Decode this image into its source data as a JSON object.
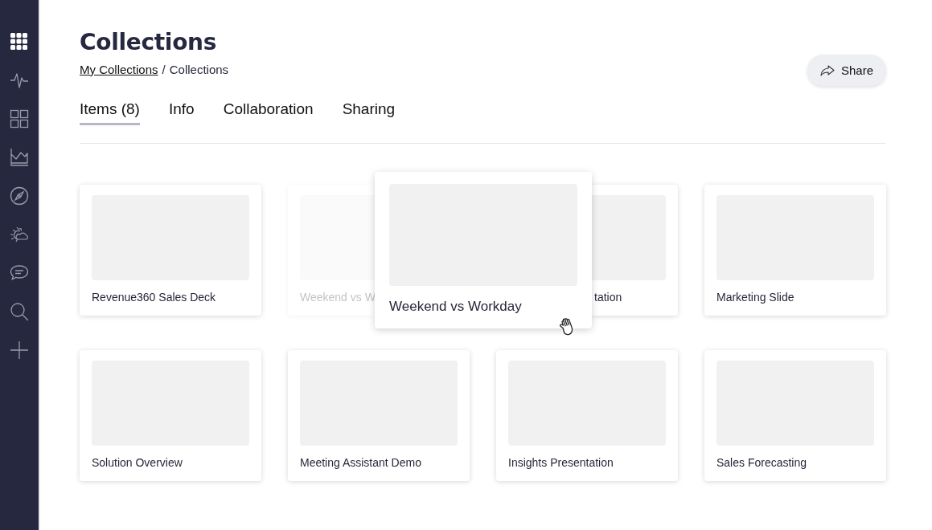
{
  "sidebar": {
    "items": [
      {
        "kind": "apps",
        "selected": true
      },
      {
        "kind": "pulse",
        "selected": false
      },
      {
        "kind": "grid",
        "selected": false
      },
      {
        "kind": "chart",
        "selected": false
      },
      {
        "kind": "compass",
        "selected": false
      },
      {
        "kind": "weather",
        "selected": false
      },
      {
        "kind": "chat",
        "selected": false
      },
      {
        "kind": "search",
        "selected": false
      },
      {
        "kind": "plus",
        "selected": false
      }
    ]
  },
  "header": {
    "title": "Collections",
    "breadcrumb": {
      "link": "My Collections",
      "separator": "/",
      "current": "Collections"
    },
    "share_button": {
      "label": "Share"
    }
  },
  "tabs": [
    {
      "label": "Items (8)",
      "selected": true
    },
    {
      "label": "Info",
      "selected": false
    },
    {
      "label": "Collaboration",
      "selected": false
    },
    {
      "label": "Sharing",
      "selected": false
    }
  ],
  "cards": [
    {
      "title": "Revenue360 Sales Deck",
      "dragging": false,
      "right_covered": false,
      "left_covered": false
    },
    {
      "title": "Weekend vs W",
      "dragging": true,
      "right_covered": true,
      "left_covered": false
    },
    {
      "title": "tation",
      "dragging": false,
      "right_covered": false,
      "left_covered": true
    },
    {
      "title": "Marketing Slide",
      "dragging": false,
      "right_covered": false,
      "left_covered": false
    },
    {
      "title": "Solution Overview",
      "dragging": false,
      "right_covered": false,
      "left_covered": false
    },
    {
      "title": "Meeting Assistant Demo",
      "dragging": false,
      "right_covered": false,
      "left_covered": false
    },
    {
      "title": "Insights Presentation",
      "dragging": false,
      "right_covered": false,
      "left_covered": false
    },
    {
      "title": "Sales Forecasting",
      "dragging": false,
      "right_covered": false,
      "left_covered": false
    }
  ],
  "dragged_card": {
    "title": "Weekend vs Workday"
  }
}
